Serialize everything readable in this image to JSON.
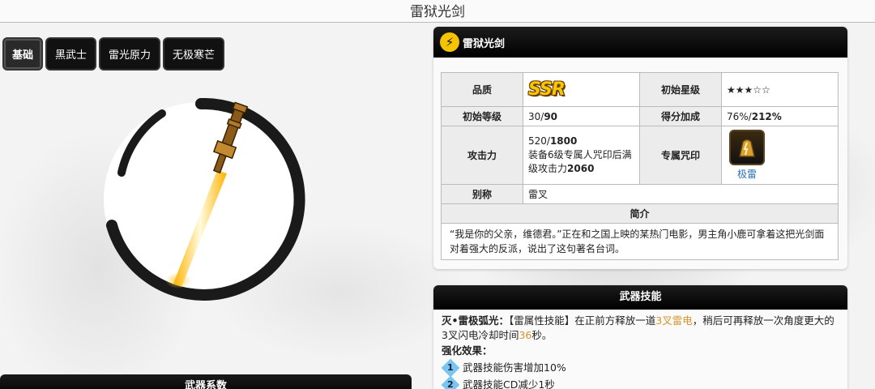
{
  "page": {
    "title": "雷狱光剑"
  },
  "tabs": [
    {
      "label": "基础",
      "active": true
    },
    {
      "label": "黑武士",
      "active": false
    },
    {
      "label": "雷光原力",
      "active": false
    },
    {
      "label": "无极寒芒",
      "active": false
    }
  ],
  "weapon_art": {
    "icon": "lightsaber-sword-image"
  },
  "left_section": {
    "header": "武器系数"
  },
  "info_card": {
    "title": "雷狱光剑",
    "title_icon": "lightning-icon",
    "rows": {
      "quality_label": "品质",
      "quality_value": "SSR",
      "initial_star_label": "初始星级",
      "initial_star_value": "★★★☆☆",
      "initial_level_label": "初始等级",
      "initial_level_min": "30/",
      "initial_level_max": "90",
      "score_bonus_label": "得分加成",
      "score_bonus_min": "76%/",
      "score_bonus_max": "212%",
      "attack_label": "攻击力",
      "attack_min": "520/",
      "attack_max": "1800",
      "attack_note": "装备6级专属人咒印后满级攻击力",
      "attack_note_value": "2060",
      "exclusive_seal_label": "专属咒印",
      "exclusive_seal_name": "极雷",
      "alias_label": "别称",
      "alias_value": "雷叉"
    },
    "intro_label": "简介",
    "intro_text": "“我是你的父亲，维德君。”正在和之国上映的某热门电影，男主角小鹿可拿着这把光剑面对着强大的反派，说出了这句著名台词。"
  },
  "skill_card": {
    "title": "武器技能",
    "skill_name": "灭•雷极弧光：",
    "skill_text_1": "【雷属性技能】在正前方释放一道",
    "skill_hl_1": "3叉雷电",
    "skill_text_2": "，稍后可再释放一次角度更大的3叉闪电冷却时间",
    "skill_hl_2": "36",
    "skill_text_3": "秒。",
    "enhance_title": "强化效果：",
    "enhancements": [
      {
        "num": "1",
        "text": "武器技能伤害增加10%"
      },
      {
        "num": "2",
        "text": "武器技能CD减少1秒"
      }
    ],
    "accent_color": "#d4952a"
  }
}
